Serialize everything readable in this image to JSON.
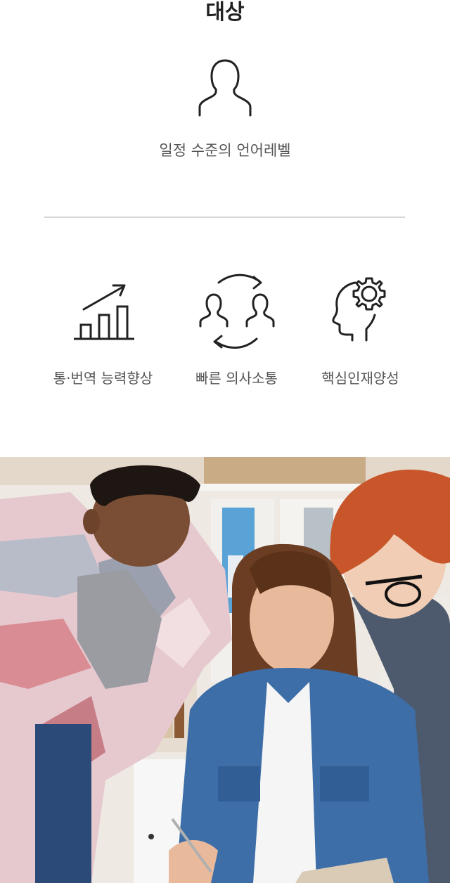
{
  "section": {
    "title": "대상",
    "subtitle": "일정 수준의 언어레벨"
  },
  "icons": {
    "main": "person-icon",
    "growth": "growth-chart-icon",
    "communication": "communication-cycle-icon",
    "talent": "head-gear-icon"
  },
  "features": [
    {
      "label": "통·번역 능력향상"
    },
    {
      "label": "빠른 의사소통"
    },
    {
      "label": "핵심인재양성"
    }
  ],
  "colors": {
    "title": "#222222",
    "text": "#555555",
    "divider": "#d6d6d6",
    "icon_stroke": "#222222"
  }
}
